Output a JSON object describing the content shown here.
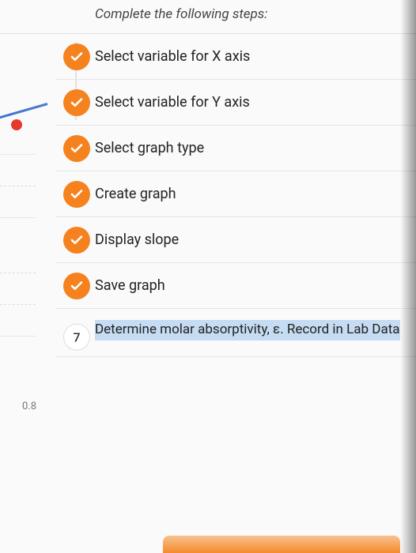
{
  "header": {
    "title": "Complete the following steps:"
  },
  "steps": [
    {
      "label": "Select variable for X axis",
      "completed": true
    },
    {
      "label": "Select variable for Y axis",
      "completed": true
    },
    {
      "label": "Select graph type",
      "completed": true
    },
    {
      "label": "Create graph",
      "completed": true
    },
    {
      "label": "Display slope",
      "completed": true
    },
    {
      "label": "Save graph",
      "completed": true
    },
    {
      "label": "Determine molar absorptivity, ε. Record in Lab Data",
      "completed": false,
      "number": "7",
      "highlighted": true
    }
  ],
  "graph_fragment": {
    "y_tick": "0.8"
  },
  "colors": {
    "accent": "#f5821f",
    "highlight_bg": "#c5dcf2",
    "line": "#3a6fc7",
    "dot": "#e5392e"
  }
}
